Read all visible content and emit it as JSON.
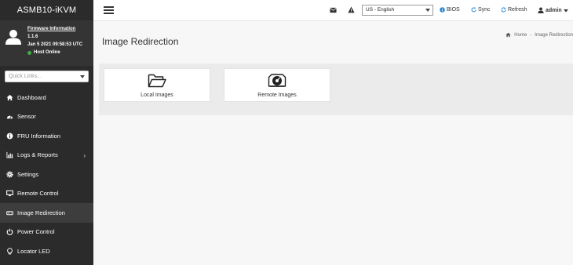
{
  "brand": "ASMB10-iKVM",
  "profile": {
    "firmware_link": "Firmware Information",
    "version": "1.1.6",
    "build_date": "Jan 5 2021 09:58:53 UTC",
    "host_status": "Host Online",
    "status_color": "#3cb043"
  },
  "quick_links": {
    "placeholder": "Quick Links..."
  },
  "nav": {
    "items": [
      {
        "label": "Dashboard",
        "icon": "dashboard-icon"
      },
      {
        "label": "Sensor",
        "icon": "sensor-icon"
      },
      {
        "label": "FRU Information",
        "icon": "fru-icon"
      },
      {
        "label": "Logs & Reports",
        "icon": "chart-icon"
      },
      {
        "label": "Settings",
        "icon": "gear-icon"
      },
      {
        "label": "Remote Control",
        "icon": "monitor-icon"
      },
      {
        "label": "Image Redirection",
        "icon": "drive-icon"
      },
      {
        "label": "Power Control",
        "icon": "power-icon"
      },
      {
        "label": "Locator LED",
        "icon": "bulb-icon"
      }
    ]
  },
  "topbar": {
    "language": "US - English",
    "bios": "BIOS",
    "sync": "Sync",
    "refresh": "Refresh",
    "user": "admin"
  },
  "page": {
    "title": "Image Redirection",
    "breadcrumb_home": "Home",
    "breadcrumb_current": "Image Redirection"
  },
  "tiles": {
    "local": "Local Images",
    "remote": "Remote Images"
  }
}
